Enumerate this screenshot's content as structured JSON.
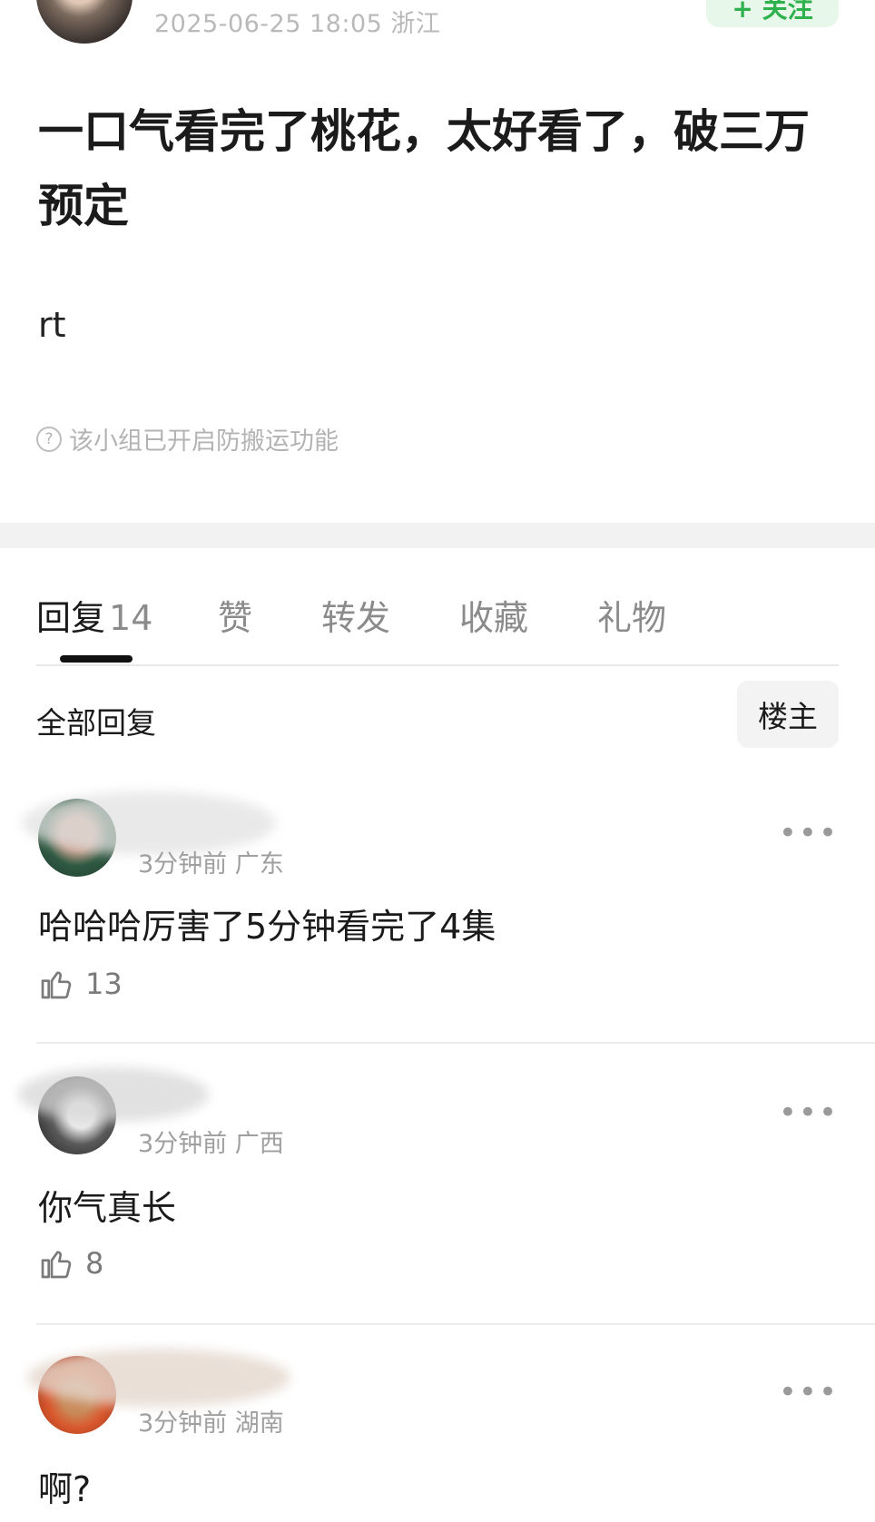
{
  "post": {
    "meta": "2025-06-25 18:05  浙江",
    "follow_label": "+ 关注",
    "title": "一口气看完了桃花，太好看了，破三万预定",
    "body": "rt",
    "notice": "该小组已开启防搬运功能"
  },
  "tabs": {
    "replies_label": "回复",
    "replies_count": "14",
    "likes_label": "赞",
    "repost_label": "转发",
    "favorite_label": "收藏",
    "gift_label": "礼物"
  },
  "replies_header": {
    "all_label": "全部回复",
    "op_filter_label": "楼主"
  },
  "comments": [
    {
      "time": "3分钟前 广东",
      "text": "哈哈哈厉害了5分钟看完了4集",
      "likes": "13"
    },
    {
      "time": "3分钟前 广西",
      "text": "你气真长",
      "likes": "8"
    },
    {
      "time": "3分钟前 湖南",
      "text": "啊?"
    }
  ],
  "colors": {
    "accent_green": "#2fb14d",
    "follow_bg": "#e7f7ea",
    "muted_text": "#9f9f9f"
  },
  "icons": [
    "help-circle-icon",
    "thumbs-up-icon",
    "more-dots-icon"
  ]
}
